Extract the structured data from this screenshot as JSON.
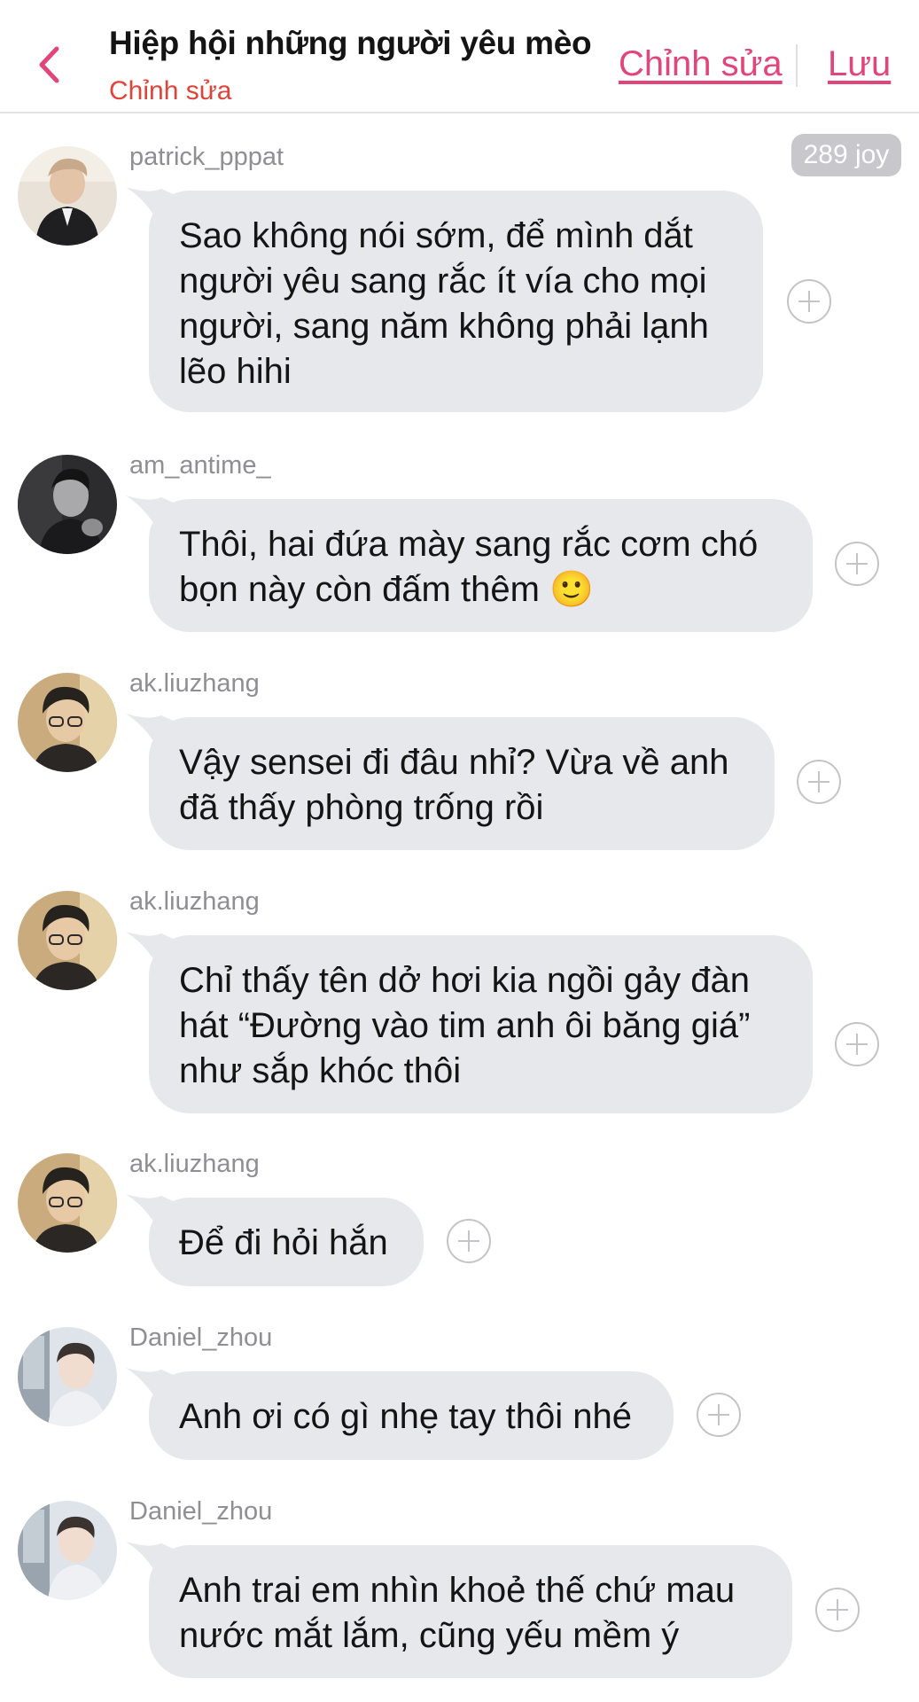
{
  "header": {
    "title": "Hiệp hội những người yêu mèo",
    "subtitle": "Chỉnh sửa",
    "edit_label": "Chỉnh sửa",
    "save_label": "Lưu",
    "back_icon": "chevron-left-icon"
  },
  "joy_badge": "289 joy",
  "colors": {
    "accent": "#e2457a",
    "subtitle": "#e0433a",
    "bubble": "#e7e8ec",
    "username": "#8e8e93"
  },
  "messages": [
    {
      "username": "patrick_pppat",
      "text": "Sao không nói sớm, để mình dắt\nngười yêu sang rắc ít vía cho mọi\nngười, sang năm không phải lạnh\nlẽo hihi"
    },
    {
      "username": "am_antime_",
      "text": "Thôi, hai đứa mày sang rắc cơm chó\nbọn này còn đấm thêm 🙂"
    },
    {
      "username": "ak.liuzhang",
      "text": "Vậy sensei đi đâu nhỉ? Vừa về anh\nđã thấy phòng trống rồi"
    },
    {
      "username": "ak.liuzhang",
      "text": "Chỉ thấy tên dở hơi kia ngồi gảy đàn\nhát “Đường vào tim anh ôi băng giá”\nnhư sắp khóc thôi"
    },
    {
      "username": "ak.liuzhang",
      "text": "Để đi hỏi hắn"
    },
    {
      "username": "Daniel_zhou",
      "text": "Anh ơi có gì nhẹ tay thôi nhé"
    },
    {
      "username": "Daniel_zhou",
      "text": "Anh trai em nhìn khoẻ thế chứ mau\nnước mắt lắm, cũng yếu mềm ý"
    }
  ]
}
